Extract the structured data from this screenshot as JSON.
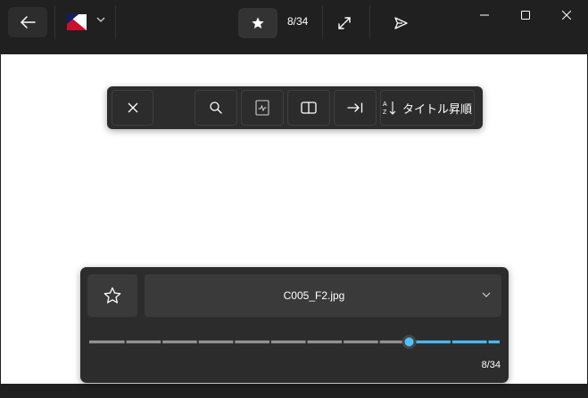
{
  "toolbar": {
    "page_indicator": "8/34",
    "back_icon": "arrow-left-icon",
    "flag_icon": "flag-icon",
    "favorite_icon": "star-filled-icon",
    "expand_icon": "expand-icon",
    "share_icon": "send-icon"
  },
  "window_controls": [
    "minimize-icon",
    "maximize-icon",
    "close-icon"
  ],
  "floating_toolbar": {
    "buttons": [
      "close-icon",
      "search-icon",
      "bookmark-icon",
      "two-page-icon",
      "arrow-to-end-icon"
    ],
    "sort_label": "タイトル昇順",
    "sort_icon": "sort-az-icon"
  },
  "nav_panel": {
    "file_name": "C005_F2.jpg",
    "page_counter": "8/34",
    "current_page": 8,
    "total_pages": 34
  },
  "colors": {
    "background": "#202020",
    "panel": "#2c2c2c",
    "button": "#3a3a3a",
    "accent": "#4cc2ff",
    "canvas": "#ffffff"
  }
}
